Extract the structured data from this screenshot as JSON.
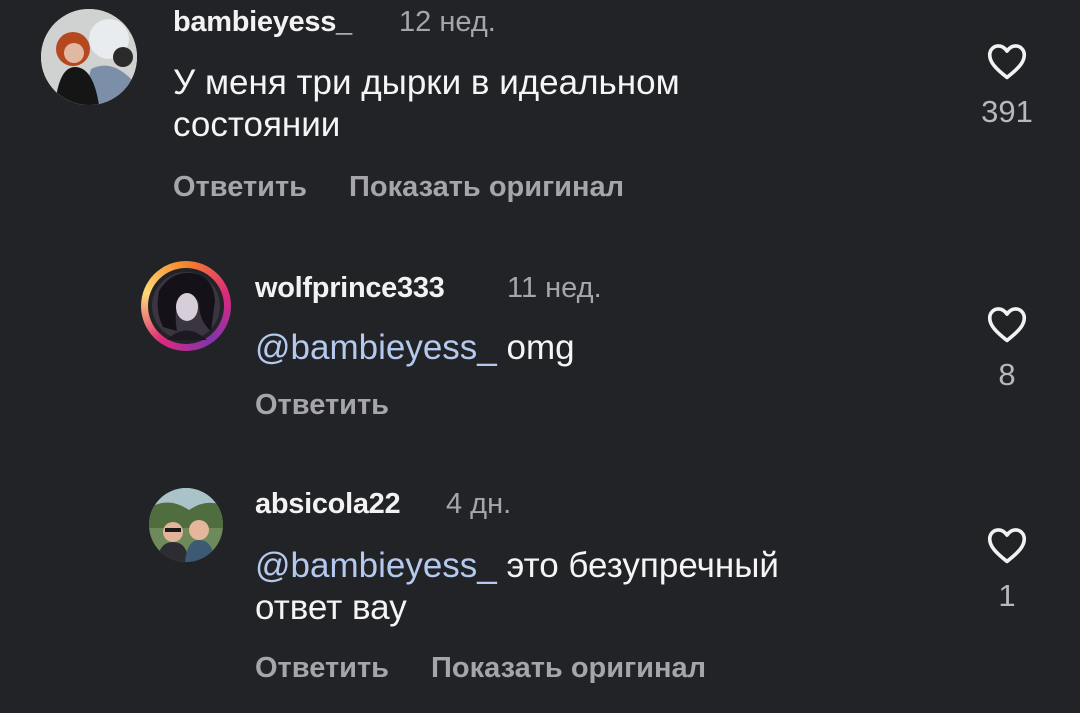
{
  "comments": [
    {
      "username": "bambieyess_",
      "time": "12 нед.",
      "mention": "",
      "text": "У меня три дырки в идеальном\nсостоянии",
      "reply_label": "Ответить",
      "translate_label": "Показать оригинал",
      "likes": "391"
    },
    {
      "username": "wolfprince333",
      "time": "11 нед.",
      "mention": "@bambieyess_",
      "text": " omg",
      "reply_label": "Ответить",
      "translate_label": "",
      "likes": "8"
    },
    {
      "username": "absicola22",
      "time": "4 дн.",
      "mention": "@bambieyess_",
      "text": " это безупречный\nответ вау",
      "reply_label": "Ответить",
      "translate_label": "Показать оригинал",
      "likes": "1"
    }
  ],
  "colors": {
    "background": "#222326",
    "mention": "#b5c9ee",
    "secondary_text": "#a6a6aa",
    "story_ring": "gradient-orange-pink-purple"
  },
  "icons": {
    "like": "heart-outline-icon"
  }
}
